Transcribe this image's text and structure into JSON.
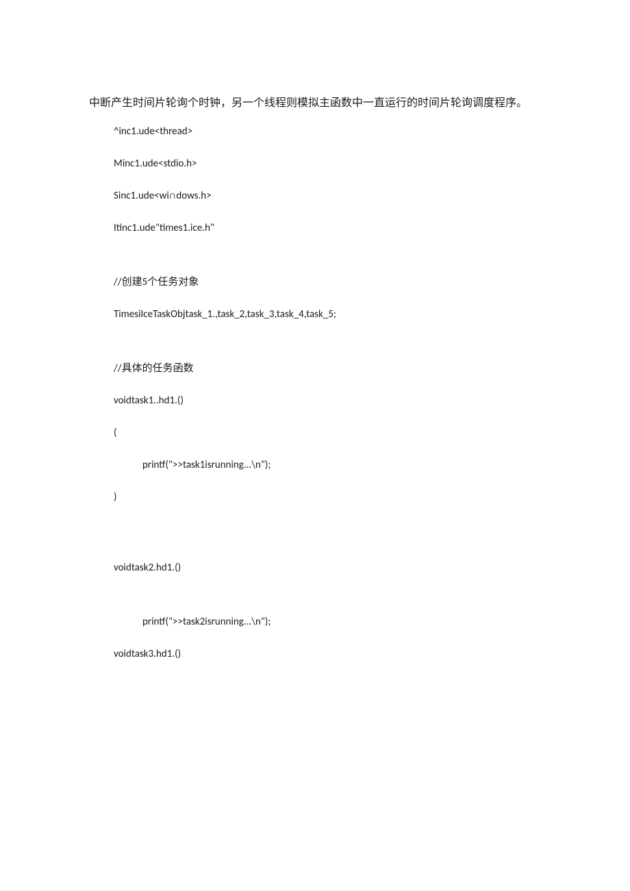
{
  "para1": "中断产生时间片轮询个时钟，另一个线程则模拟主函数中一直运行的时间片轮询调度程序。",
  "lines": {
    "l1": "^inc1.ude<thread>",
    "l2": "Minc1.ude<stdio.h>",
    "l3": "Sinc1.ude<wi∩dows.h>",
    "l4": "Itinc1.ude\"times1.ice.h\"",
    "l5": "//创建5个任务对象",
    "l6": "TimesiIceTaskObjtask_1.,task_2,task_3,task_4,task_5;",
    "l7": "//具体的任务函数",
    "l8": "voidtask1..hd1.()",
    "l9": "(",
    "l10": "printf(\">>task1isrunning...\\n\");",
    "l11": ")",
    "l12": "voidtask2.hd1.()",
    "l13": "printf(\">>task2isrunning...\\n\");",
    "l14": "voidtask3.hd1.()"
  }
}
